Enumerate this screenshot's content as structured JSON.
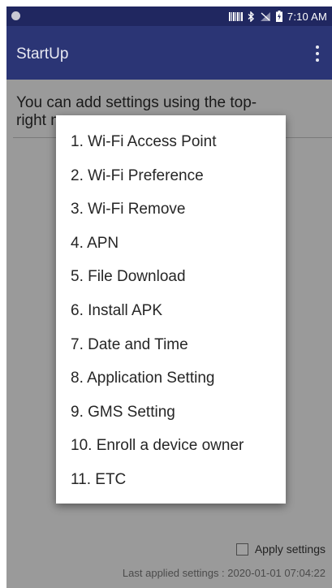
{
  "status_bar": {
    "time": "7:10 AM"
  },
  "app_bar": {
    "title": "StartUp"
  },
  "content": {
    "info_text": "You can add settings using the top-right menu.",
    "apply_label": "Apply settings",
    "apply_checked": false,
    "last_applied": "Last applied settings : 2020-01-01 07:04:22"
  },
  "menu": {
    "items": [
      {
        "label": "1. Wi-Fi Access Point"
      },
      {
        "label": "2. Wi-Fi Preference"
      },
      {
        "label": "3. Wi-Fi Remove"
      },
      {
        "label": "4. APN"
      },
      {
        "label": "5. File Download"
      },
      {
        "label": "6. Install APK"
      },
      {
        "label": "7. Date and Time"
      },
      {
        "label": "8. Application Setting"
      },
      {
        "label": "9. GMS Setting"
      },
      {
        "label": "10. Enroll a device owner"
      },
      {
        "label": "11. ETC"
      }
    ]
  },
  "colors": {
    "status_bar": "#202760",
    "app_bar": "#2b3575",
    "scrim_background": "#9a9a9a",
    "menu_background": "#ffffff"
  }
}
